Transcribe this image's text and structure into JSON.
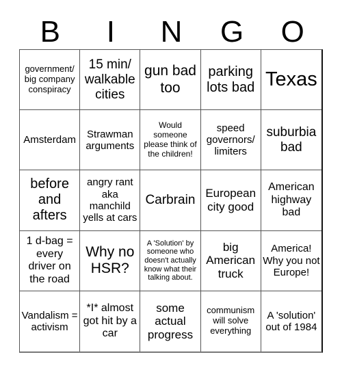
{
  "header": [
    "B",
    "I",
    "N",
    "G",
    "O"
  ],
  "cells": [
    "government/ big company conspiracy",
    "15 min/ walkable cities",
    "gun bad too",
    "parking lots bad",
    "Texas",
    "Amsterdam",
    "Strawman arguments",
    "Would someone please think of the children!",
    "speed governors/ limiters",
    "suburbia bad",
    "before and afters",
    "angry rant aka manchild yells at cars",
    "Carbrain",
    "European city good",
    "American highway bad",
    "1 d-bag = every driver on the road",
    "Why no HSR?",
    "A 'Solution' by someone who doesn't actually know what their talking about.",
    "big American truck",
    "America! Why you not Europe!",
    "Vandalism = activism",
    "*I* almost got hit by a car",
    "some actual progress",
    "communism will solve everything",
    "A 'solution' out of 1984"
  ]
}
